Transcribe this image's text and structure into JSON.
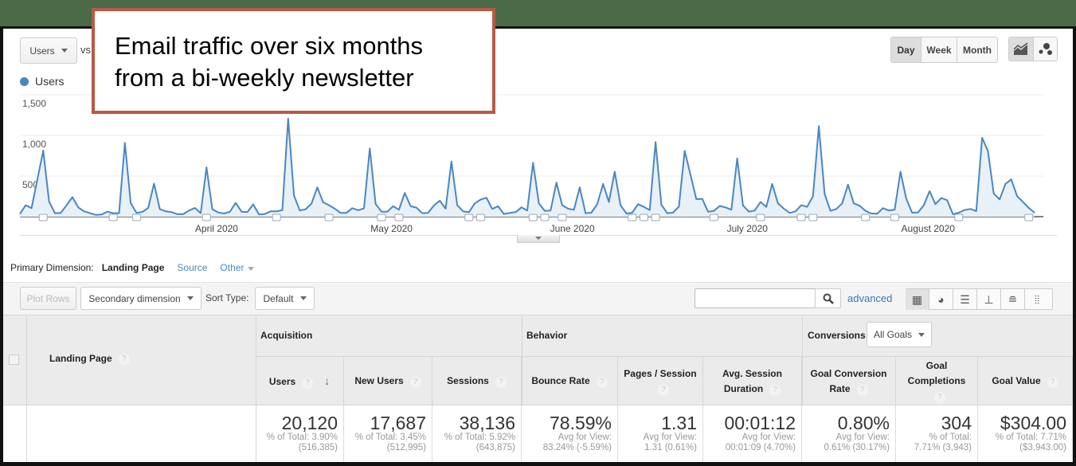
{
  "callout": {
    "line1": "Email traffic over six months",
    "line2": "from a bi-weekly newsletter"
  },
  "toolbar": {
    "metric_select": "Users",
    "vs_label": "vs",
    "legend_label": "Users",
    "legend_color": "#4a87c0",
    "granularity": [
      "Day",
      "Week",
      "Month"
    ],
    "granularity_selected": "Day",
    "chart_types": [
      {
        "icon": "line-chart-icon",
        "selected": true
      },
      {
        "icon": "motion-chart-icon",
        "selected": false
      }
    ]
  },
  "chart_data": {
    "type": "area",
    "series": [
      {
        "name": "Users",
        "color": "#4a87c0",
        "start_date": "2020-03-01",
        "interval": "day",
        "values": [
          33,
          141,
          105,
          460,
          813,
          187,
          43,
          46,
          140,
          240,
          115,
          66,
          43,
          23,
          26,
          62,
          43,
          43,
          908,
          167,
          46,
          59,
          108,
          407,
          92,
          66,
          56,
          30,
          30,
          75,
          108,
          43,
          607,
          92,
          52,
          39,
          59,
          171,
          62,
          56,
          151,
          26,
          33,
          66,
          66,
          79,
          1207,
          262,
          75,
          92,
          161,
          361,
          177,
          141,
          98,
          46,
          46,
          105,
          79,
          102,
          840,
          157,
          62,
          62,
          128,
          85,
          292,
          128,
          112,
          43,
          46,
          138,
          197,
          98,
          679,
          141,
          66,
          56,
          164,
          210,
          233,
          95,
          128,
          33,
          46,
          56,
          115,
          75,
          663,
          164,
          72,
          75,
          420,
          141,
          98,
          85,
          361,
          43,
          49,
          154,
          403,
          180,
          554,
          141,
          39,
          49,
          154,
          121,
          82,
          918,
          148,
          43,
          49,
          125,
          810,
          515,
          216,
          220,
          62,
          72,
          131,
          115,
          85,
          718,
          138,
          62,
          75,
          180,
          121,
          403,
          164,
          98,
          46,
          66,
          141,
          121,
          253,
          1115,
          279,
          72,
          95,
          164,
          394,
          164,
          134,
          72,
          39,
          36,
          105,
          75,
          85,
          554,
          220,
          49,
          52,
          141,
          315,
          154,
          230,
          203,
          30,
          49,
          82,
          95,
          69,
          971,
          810,
          285,
          213,
          403,
          459,
          253,
          180,
          108,
          49
        ]
      }
    ],
    "yticks": [
      "500",
      "1,000",
      "1,500"
    ],
    "ylim": [
      0,
      1500
    ],
    "xticks": [
      "April 2020",
      "May 2020",
      "June 2020",
      "July 2020",
      "August 2020"
    ],
    "grid": true
  },
  "dimension": {
    "label": "Primary Dimension:",
    "options": [
      "Landing Page",
      "Source",
      "Other"
    ],
    "selected": "Landing Page"
  },
  "table_toolbar": {
    "plot_rows": "Plot Rows",
    "secondary_dimension": "Secondary dimension",
    "sort_type_label": "Sort Type:",
    "sort_type": "Default",
    "search_placeholder": "",
    "advanced": "advanced",
    "views": [
      "table-view-icon",
      "pie-view-icon",
      "bar-view-icon",
      "comparison-view-icon",
      "term-cloud-icon",
      "pivot-view-icon"
    ]
  },
  "table": {
    "dimension_header": "Landing Page",
    "groups": {
      "acquisition": "Acquisition",
      "behavior": "Behavior",
      "conversions": "Conversions",
      "goal_select": "All Goals"
    },
    "columns": [
      "Users",
      "New Users",
      "Sessions",
      "Bounce Rate",
      "Pages / Session",
      "Avg. Session Duration",
      "Goal Conversion Rate",
      "Goal Completions",
      "Goal Value"
    ],
    "totals": [
      {
        "value": "20,120",
        "sub1": "% of Total: 3.90%",
        "sub2": "(516,385)"
      },
      {
        "value": "17,687",
        "sub1": "% of Total: 3.45%",
        "sub2": "(512,995)"
      },
      {
        "value": "38,136",
        "sub1": "% of Total: 5.92%",
        "sub2": "(643,875)"
      },
      {
        "value": "78.59%",
        "sub1": "Avg for View:",
        "sub2": "83.24% (-5.59%)"
      },
      {
        "value": "1.31",
        "sub1": "Avg for View:",
        "sub2": "1.31 (0.61%)"
      },
      {
        "value": "00:01:12",
        "sub1": "Avg for View:",
        "sub2": "00:01:09 (4.70%)"
      },
      {
        "value": "0.80%",
        "sub1": "Avg for View:",
        "sub2": "0.61% (30.17%)"
      },
      {
        "value": "304",
        "sub1": "% of Total:",
        "sub2": "7.71% (3,943)"
      },
      {
        "value": "$304.00",
        "sub1": "% of Total: 7.71%",
        "sub2": "($3,943.00)"
      }
    ]
  }
}
